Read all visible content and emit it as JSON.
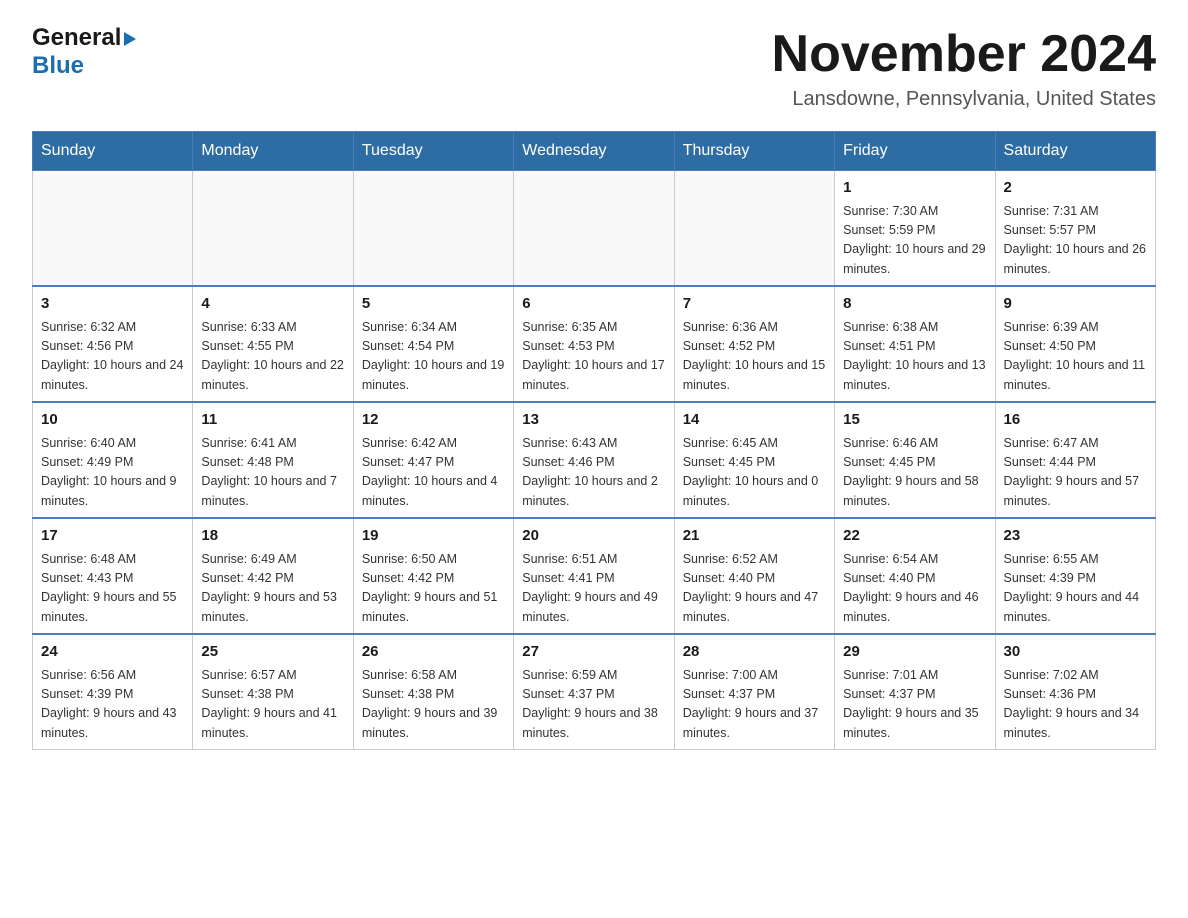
{
  "logo": {
    "line1": "General",
    "arrow": "▶",
    "line2": "Blue"
  },
  "title": "November 2024",
  "subtitle": "Lansdowne, Pennsylvania, United States",
  "days_of_week": [
    "Sunday",
    "Monday",
    "Tuesday",
    "Wednesday",
    "Thursday",
    "Friday",
    "Saturday"
  ],
  "weeks": [
    [
      {
        "num": "",
        "info": ""
      },
      {
        "num": "",
        "info": ""
      },
      {
        "num": "",
        "info": ""
      },
      {
        "num": "",
        "info": ""
      },
      {
        "num": "",
        "info": ""
      },
      {
        "num": "1",
        "info": "Sunrise: 7:30 AM\nSunset: 5:59 PM\nDaylight: 10 hours and 29 minutes."
      },
      {
        "num": "2",
        "info": "Sunrise: 7:31 AM\nSunset: 5:57 PM\nDaylight: 10 hours and 26 minutes."
      }
    ],
    [
      {
        "num": "3",
        "info": "Sunrise: 6:32 AM\nSunset: 4:56 PM\nDaylight: 10 hours and 24 minutes."
      },
      {
        "num": "4",
        "info": "Sunrise: 6:33 AM\nSunset: 4:55 PM\nDaylight: 10 hours and 22 minutes."
      },
      {
        "num": "5",
        "info": "Sunrise: 6:34 AM\nSunset: 4:54 PM\nDaylight: 10 hours and 19 minutes."
      },
      {
        "num": "6",
        "info": "Sunrise: 6:35 AM\nSunset: 4:53 PM\nDaylight: 10 hours and 17 minutes."
      },
      {
        "num": "7",
        "info": "Sunrise: 6:36 AM\nSunset: 4:52 PM\nDaylight: 10 hours and 15 minutes."
      },
      {
        "num": "8",
        "info": "Sunrise: 6:38 AM\nSunset: 4:51 PM\nDaylight: 10 hours and 13 minutes."
      },
      {
        "num": "9",
        "info": "Sunrise: 6:39 AM\nSunset: 4:50 PM\nDaylight: 10 hours and 11 minutes."
      }
    ],
    [
      {
        "num": "10",
        "info": "Sunrise: 6:40 AM\nSunset: 4:49 PM\nDaylight: 10 hours and 9 minutes."
      },
      {
        "num": "11",
        "info": "Sunrise: 6:41 AM\nSunset: 4:48 PM\nDaylight: 10 hours and 7 minutes."
      },
      {
        "num": "12",
        "info": "Sunrise: 6:42 AM\nSunset: 4:47 PM\nDaylight: 10 hours and 4 minutes."
      },
      {
        "num": "13",
        "info": "Sunrise: 6:43 AM\nSunset: 4:46 PM\nDaylight: 10 hours and 2 minutes."
      },
      {
        "num": "14",
        "info": "Sunrise: 6:45 AM\nSunset: 4:45 PM\nDaylight: 10 hours and 0 minutes."
      },
      {
        "num": "15",
        "info": "Sunrise: 6:46 AM\nSunset: 4:45 PM\nDaylight: 9 hours and 58 minutes."
      },
      {
        "num": "16",
        "info": "Sunrise: 6:47 AM\nSunset: 4:44 PM\nDaylight: 9 hours and 57 minutes."
      }
    ],
    [
      {
        "num": "17",
        "info": "Sunrise: 6:48 AM\nSunset: 4:43 PM\nDaylight: 9 hours and 55 minutes."
      },
      {
        "num": "18",
        "info": "Sunrise: 6:49 AM\nSunset: 4:42 PM\nDaylight: 9 hours and 53 minutes."
      },
      {
        "num": "19",
        "info": "Sunrise: 6:50 AM\nSunset: 4:42 PM\nDaylight: 9 hours and 51 minutes."
      },
      {
        "num": "20",
        "info": "Sunrise: 6:51 AM\nSunset: 4:41 PM\nDaylight: 9 hours and 49 minutes."
      },
      {
        "num": "21",
        "info": "Sunrise: 6:52 AM\nSunset: 4:40 PM\nDaylight: 9 hours and 47 minutes."
      },
      {
        "num": "22",
        "info": "Sunrise: 6:54 AM\nSunset: 4:40 PM\nDaylight: 9 hours and 46 minutes."
      },
      {
        "num": "23",
        "info": "Sunrise: 6:55 AM\nSunset: 4:39 PM\nDaylight: 9 hours and 44 minutes."
      }
    ],
    [
      {
        "num": "24",
        "info": "Sunrise: 6:56 AM\nSunset: 4:39 PM\nDaylight: 9 hours and 43 minutes."
      },
      {
        "num": "25",
        "info": "Sunrise: 6:57 AM\nSunset: 4:38 PM\nDaylight: 9 hours and 41 minutes."
      },
      {
        "num": "26",
        "info": "Sunrise: 6:58 AM\nSunset: 4:38 PM\nDaylight: 9 hours and 39 minutes."
      },
      {
        "num": "27",
        "info": "Sunrise: 6:59 AM\nSunset: 4:37 PM\nDaylight: 9 hours and 38 minutes."
      },
      {
        "num": "28",
        "info": "Sunrise: 7:00 AM\nSunset: 4:37 PM\nDaylight: 9 hours and 37 minutes."
      },
      {
        "num": "29",
        "info": "Sunrise: 7:01 AM\nSunset: 4:37 PM\nDaylight: 9 hours and 35 minutes."
      },
      {
        "num": "30",
        "info": "Sunrise: 7:02 AM\nSunset: 4:36 PM\nDaylight: 9 hours and 34 minutes."
      }
    ]
  ]
}
